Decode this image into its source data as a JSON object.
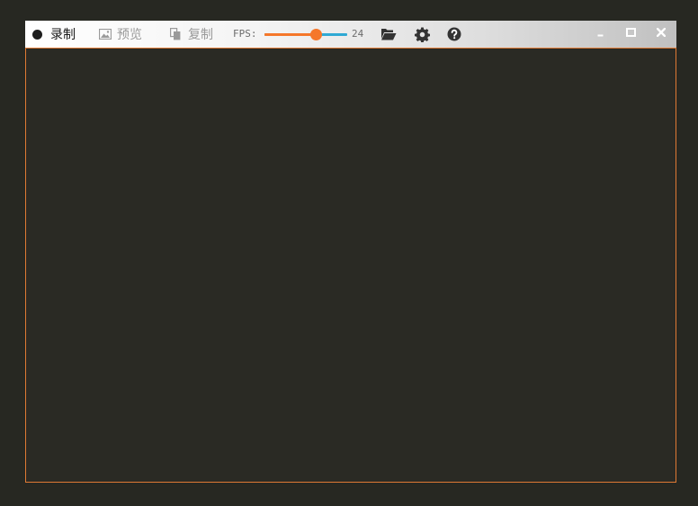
{
  "toolbar": {
    "record_label": "录制",
    "preview_label": "预览",
    "copy_label": "复制",
    "fps_label": "FPS:",
    "fps_value": "24",
    "fps_slider_fraction": 0.62,
    "icons": {
      "record": "record-dot-icon",
      "preview": "image-icon",
      "copy": "copy-icon",
      "folder": "folder-open-icon",
      "settings": "gear-icon",
      "help": "help-circle-icon",
      "minimize": "minimize-icon",
      "maximize": "maximize-icon",
      "close": "close-icon"
    }
  },
  "colors": {
    "accent": "#f5772a",
    "slider_track": "#2fa9d4",
    "border": "#e07a34",
    "background": "#272822",
    "capture_area": "#2a2a24"
  }
}
